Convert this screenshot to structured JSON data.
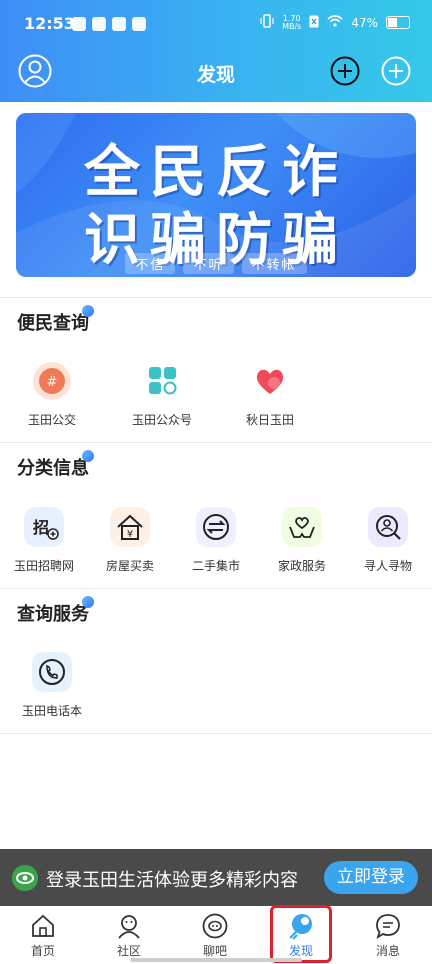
{
  "status": {
    "time": "12:53",
    "net_speed_value": "1.70",
    "net_speed_unit": "MB/s",
    "battery": "47%"
  },
  "header": {
    "title": "发现"
  },
  "banner": {
    "line1": "全民反诈",
    "line2": "识骗防骗",
    "tags": [
      "不信",
      "不听",
      "不转帐"
    ]
  },
  "sections": {
    "convenience": {
      "title": "便民查询",
      "items": [
        {
          "label": "玉田公交",
          "icon": "bus-icon"
        },
        {
          "label": "玉田公众号",
          "icon": "apps-icon"
        },
        {
          "label": "秋日玉田",
          "icon": "heart-icon"
        }
      ]
    },
    "classified": {
      "title": "分类信息",
      "items": [
        {
          "label": "玉田招聘网",
          "icon": "recruit-icon"
        },
        {
          "label": "房屋买卖",
          "icon": "house-icon"
        },
        {
          "label": "二手集市",
          "icon": "exchange-icon"
        },
        {
          "label": "家政服务",
          "icon": "care-icon"
        },
        {
          "label": "寻人寻物",
          "icon": "search-person-icon"
        }
      ]
    },
    "query": {
      "title": "查询服务",
      "items": [
        {
          "label": "玉田电话本",
          "icon": "phone-icon"
        }
      ]
    }
  },
  "login_bar": {
    "text": "登录玉田生活体验更多精彩内容",
    "button": "立即登录"
  },
  "tabbar": {
    "items": [
      {
        "label": "首页",
        "icon": "home-icon"
      },
      {
        "label": "社区",
        "icon": "community-icon"
      },
      {
        "label": "聊吧",
        "icon": "chat-icon"
      },
      {
        "label": "发现",
        "icon": "discover-icon",
        "active": true
      },
      {
        "label": "消息",
        "icon": "message-icon"
      }
    ]
  },
  "colors": {
    "primary": "#2d7cf2",
    "login_button": "#3aa5ee",
    "highlight": "#e0202a"
  }
}
